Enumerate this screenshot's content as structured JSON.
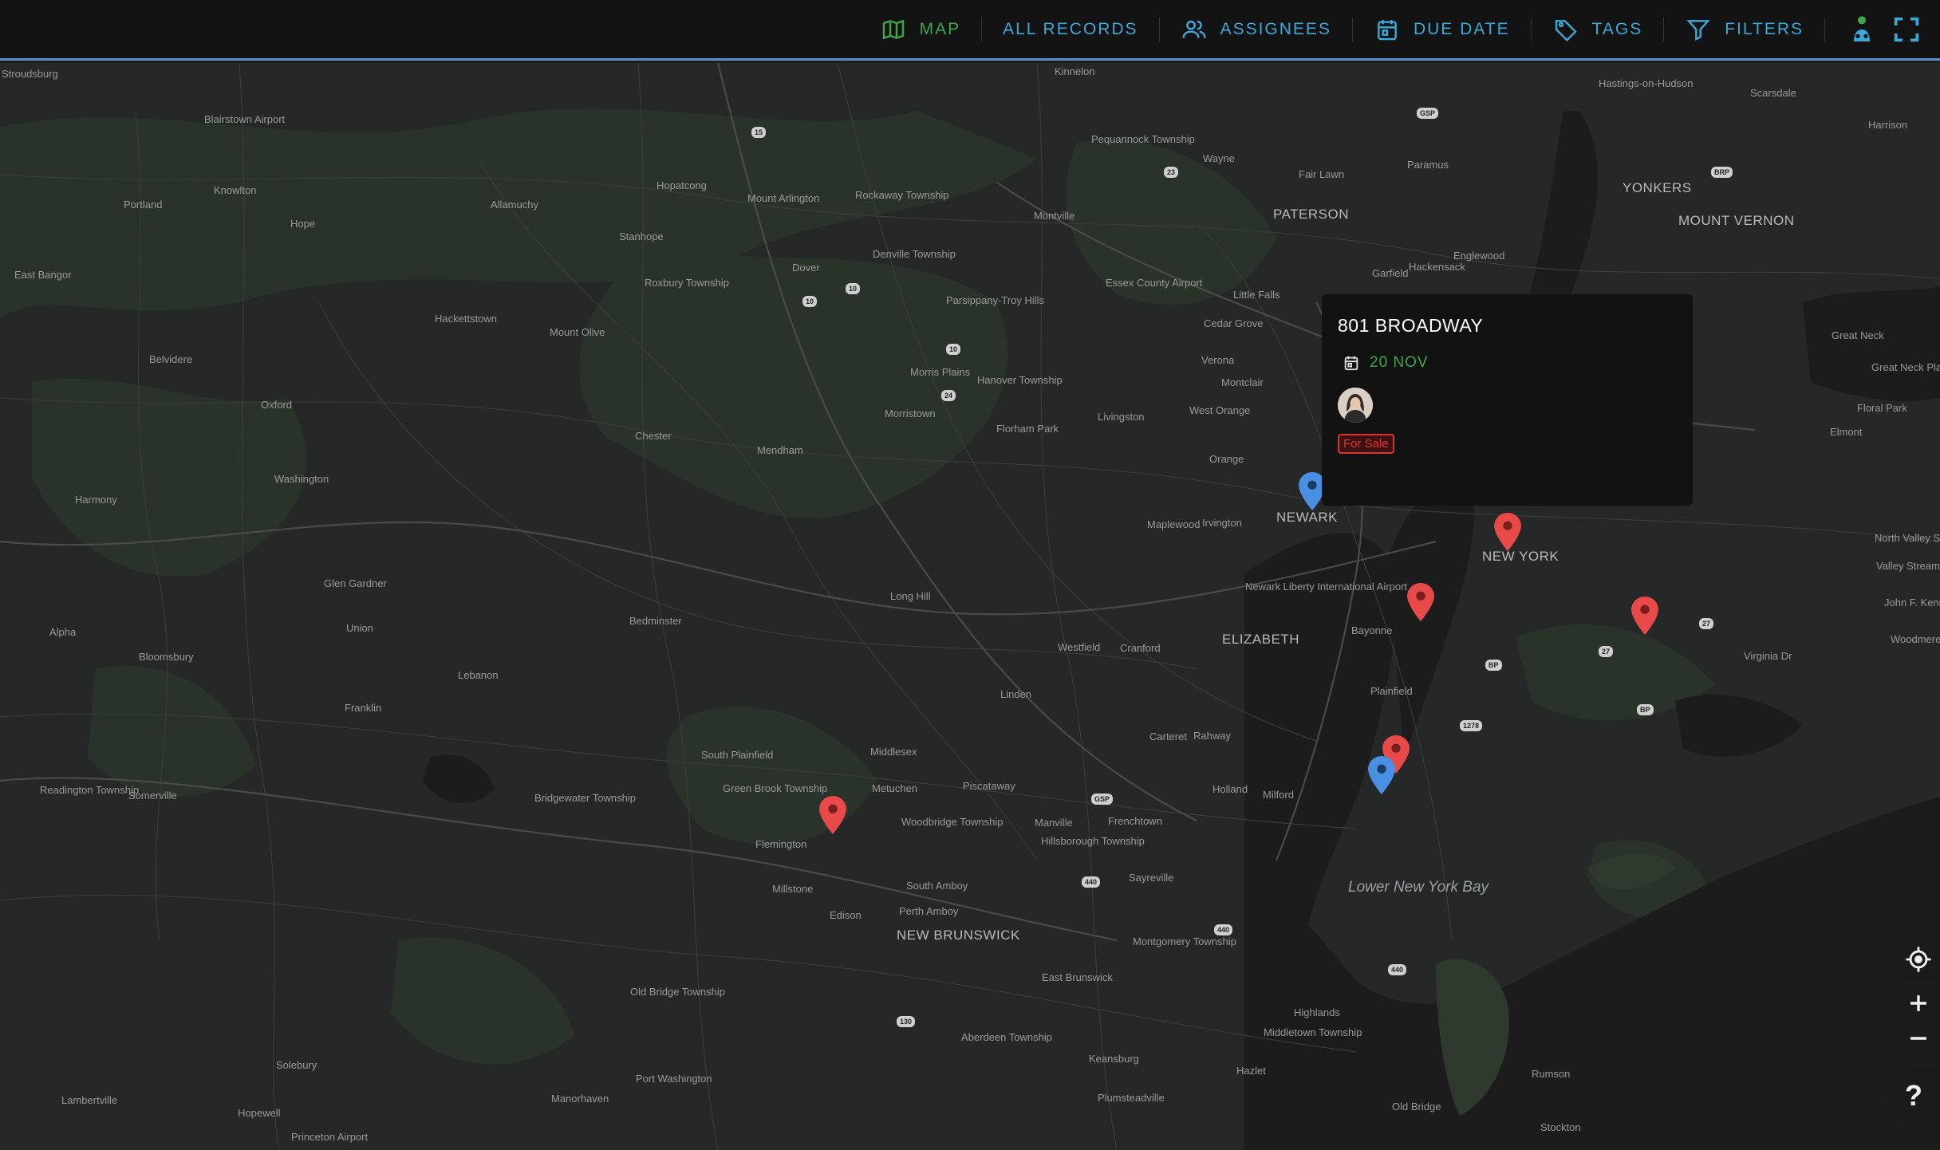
{
  "nav": {
    "items": [
      {
        "label": "MAP",
        "icon": "map-icon",
        "active": true
      },
      {
        "label": "ALL RECORDS",
        "icon": "",
        "active": false
      },
      {
        "label": "ASSIGNEES",
        "icon": "people-icon",
        "active": false
      },
      {
        "label": "DUE DATE",
        "icon": "calendar-icon",
        "active": false
      },
      {
        "label": "TAGS",
        "icon": "tag-icon",
        "active": false
      },
      {
        "label": "FILTERS",
        "icon": "filter-icon",
        "active": false
      }
    ],
    "account_icon": "person-tree-icon",
    "fullscreen_icon": "fullscreen-icon"
  },
  "colors": {
    "accent": "#3aa8d8",
    "active": "#3ea64a",
    "pin_red": "#e84a4a",
    "pin_blue": "#4a90e2",
    "popup_bg": "#121212",
    "badge": "#e03131"
  },
  "popup": {
    "title": "801 BROADWAY",
    "date": "20 NOV",
    "tag": "For Sale"
  },
  "map": {
    "cities_major": [
      "NEWARK",
      "NEW YORK",
      "ELIZABETH",
      "NEW BRUNSWICK",
      "PATERSON",
      "YONKERS",
      "MOUNT VERNON"
    ],
    "water": "Lower New York Bay",
    "places": [
      "Stroudsburg",
      "Blairstown Airport",
      "Portland",
      "Knowlton",
      "Hope",
      "Allamuchy",
      "Hopatcong",
      "Mount Arlington",
      "Stanhope",
      "Rockaway Township",
      "Montville",
      "Pequannock Township",
      "Wayne",
      "Kinnelon",
      "Paramus",
      "Fair Lawn",
      "Hastings-on-Hudson",
      "Scarsdale",
      "Harrison",
      "East Bangor",
      "Belvidere",
      "Hackettstown",
      "Mount Olive",
      "Roxbury Township",
      "Dover",
      "Denville Township",
      "Parsippany-Troy Hills",
      "Essex County Airport",
      "Little Falls",
      "Garfield",
      "Hackensack",
      "Englewood",
      "Cedar Grove",
      "Verona",
      "Montclair",
      "Morris Plains",
      "Hanover Township",
      "Morristown",
      "Florham Park",
      "Livingston",
      "West Orange",
      "Orange",
      "Oxford",
      "Chester",
      "Mendham",
      "Harmony",
      "Washington",
      "Maplewood",
      "Irvington",
      "Glen Gardner",
      "Alpha",
      "Union",
      "Bloomsbury",
      "Lebanon",
      "Franklin",
      "Bedminster",
      "Long Hill",
      "Westfield",
      "Cranford",
      "Newark Liberty International Airport",
      "Bayonne",
      "Plainfield",
      "Linden",
      "Rahway",
      "Carteret",
      "Holland",
      "Milford",
      "Readington Township",
      "Somerville",
      "Bridgewater Township",
      "Green Brook Township",
      "South Plainfield",
      "Middlesex",
      "Piscataway",
      "Metuchen",
      "Woodbridge Township",
      "Manville",
      "Frenchtown",
      "Flemington",
      "Hillsborough Township",
      "Millstone",
      "Edison",
      "Perth Amboy",
      "South Amboy",
      "Sayreville",
      "Montgomery Township",
      "East Brunswick",
      "Old Bridge Township",
      "Aberdeen Township",
      "Keansburg",
      "Hazlet",
      "Highlands",
      "Middletown Township",
      "Rumson",
      "Old Bridge",
      "Stockton",
      "Plumsteadville",
      "Solebury",
      "Lambertville",
      "Hopewell",
      "Princeton Airport",
      "Manorhaven",
      "Port Washington",
      "Great Neck",
      "Great Neck Plaza",
      "Floral Park",
      "Elmont",
      "North Valley Stream",
      "Valley Stream",
      "John F. Kennedy International Airport",
      "Woodmere",
      "Virginia Dr"
    ]
  },
  "controls": {
    "locate_icon": "locate-icon",
    "zoom_in_icon": "plus-icon",
    "zoom_out_icon": "minus-icon",
    "help": "?"
  }
}
